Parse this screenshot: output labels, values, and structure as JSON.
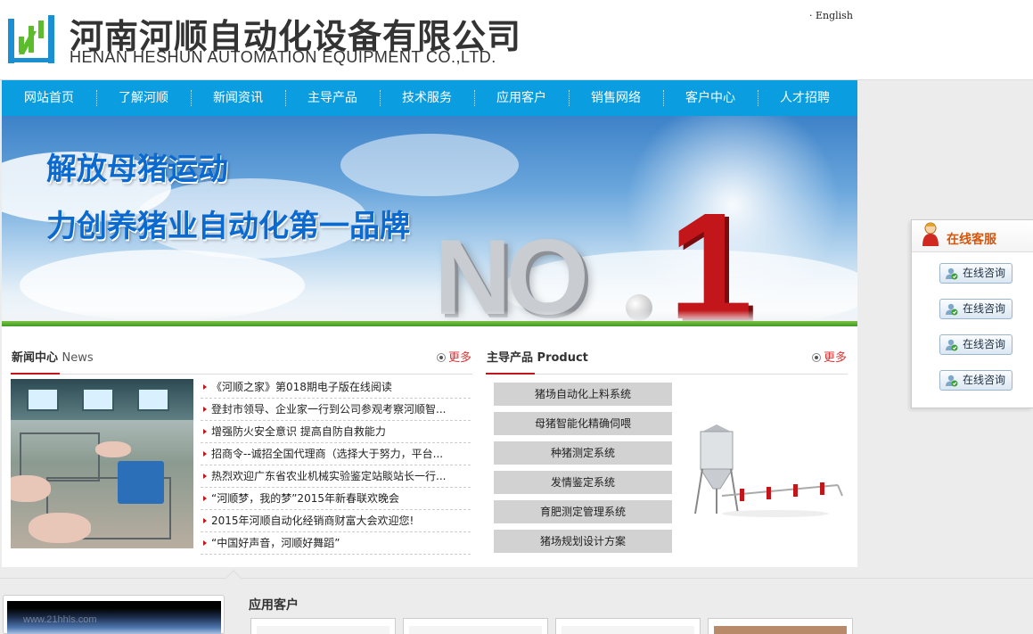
{
  "header": {
    "company_cn": "河南河顺自动化设备有限公司",
    "company_en": "HENAN HESHUN AUTOMATION EQUIPMENT CO.,LTD.",
    "english_link": "· English",
    "logo_icon": "heshun-logo-icon"
  },
  "nav": {
    "items": [
      {
        "label": "网站首页"
      },
      {
        "label": "了解河顺"
      },
      {
        "label": "新闻资讯"
      },
      {
        "label": "主导产品"
      },
      {
        "label": "技术服务"
      },
      {
        "label": "应用客户"
      },
      {
        "label": "销售网络"
      },
      {
        "label": "客户中心"
      },
      {
        "label": "人才招聘"
      }
    ]
  },
  "banner": {
    "slogan_line1": "解放母猪运动",
    "slogan_line2": "力创养猪业自动化第一品牌",
    "big_text_no": "NO",
    "big_text_one": "1"
  },
  "news": {
    "title": "新闻中心",
    "title_en": "News",
    "more_label": "更多",
    "items": [
      {
        "text": "《河顺之家》第018期电子版在线阅读"
      },
      {
        "text": "登封市领导、企业家一行到公司参观考察河顺智..."
      },
      {
        "text": "增强防火安全意识 提高自防自救能力"
      },
      {
        "text": "招商令--诚招全国代理商（选择大于努力，平台..."
      },
      {
        "text": "热烈欢迎广东省农业机械实验鉴定站賧站长一行..."
      },
      {
        "text": "“河顺梦，我的梦”2015年新春联欢晚会"
      },
      {
        "text": "2015年河顺自动化经销商财富大会欢迎您!"
      },
      {
        "text": "“中国好声音，河顺好舞蹈”"
      }
    ]
  },
  "products": {
    "title": "主导产品",
    "title_en": "Product",
    "more_label": "更多",
    "items": [
      {
        "label": "猪场自动化上料系统"
      },
      {
        "label": "母猪智能化精确伺喂"
      },
      {
        "label": "种猪测定系统"
      },
      {
        "label": "发情鉴定系统"
      },
      {
        "label": "育肥测定管理系统"
      },
      {
        "label": "猪场规划设计方案"
      }
    ]
  },
  "bottom": {
    "video_watermark": "www.21hhls.com",
    "clients_title": "应用客户"
  },
  "service": {
    "title": "在线客服",
    "buttons": [
      {
        "label": "在线咨询"
      },
      {
        "label": "在线咨询"
      },
      {
        "label": "在线咨询"
      },
      {
        "label": "在线咨询"
      }
    ]
  },
  "colors": {
    "nav_blue": "#0a9ee0",
    "accent_red": "#c2161b",
    "service_orange": "#d6550b",
    "logo_blue": "#1a8fd2",
    "logo_green": "#5dbb2e"
  }
}
